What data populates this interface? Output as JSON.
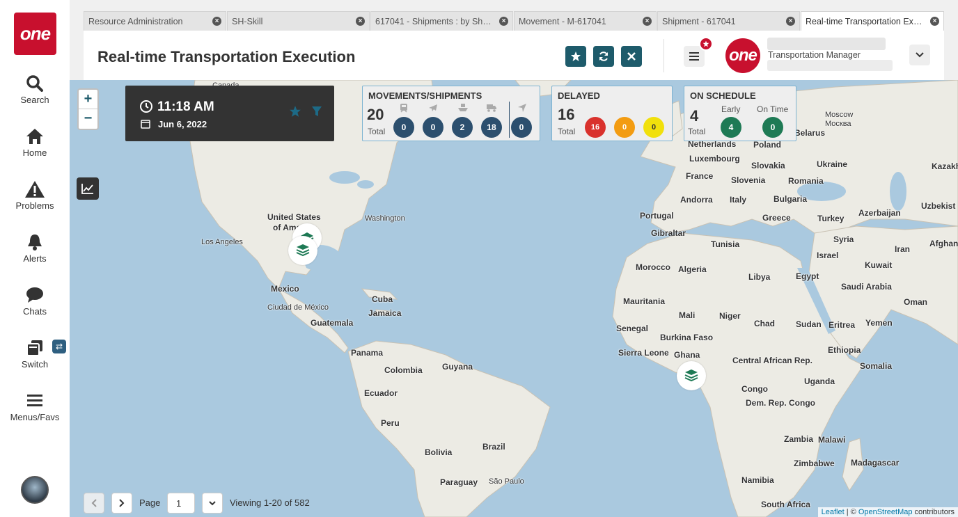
{
  "nav": {
    "logo": "one",
    "items": [
      {
        "label": "Search",
        "icon": "search-icon"
      },
      {
        "label": "Home",
        "icon": "home-icon"
      },
      {
        "label": "Problems",
        "icon": "warning-icon"
      },
      {
        "label": "Alerts",
        "icon": "bell-icon"
      },
      {
        "label": "Chats",
        "icon": "chat-icon"
      },
      {
        "label": "Switch",
        "icon": "switch-icon"
      },
      {
        "label": "Menus/Favs",
        "icon": "menu-icon"
      }
    ]
  },
  "tabs": [
    {
      "label": "Resource Administration"
    },
    {
      "label": "SH-Skill"
    },
    {
      "label": "617041 - Shipments : by Ship..."
    },
    {
      "label": "Movement - M-617041"
    },
    {
      "label": "Shipment - 617041"
    },
    {
      "label": "Real-time Transportation Exe..."
    }
  ],
  "header": {
    "title": "Real-time Transportation Execution",
    "user_logo": "one",
    "user_role": "Transportation Manager"
  },
  "clock": {
    "time": "11:18 AM",
    "date": "Jun 6, 2022"
  },
  "movements": {
    "title": "MOVEMENTS/SHIPMENTS",
    "total": "20",
    "total_label": "Total",
    "counts": [
      "0",
      "0",
      "2",
      "18",
      "0"
    ]
  },
  "delayed": {
    "title": "DELAYED",
    "total": "16",
    "total_label": "Total",
    "counts": [
      "16",
      "0",
      "0"
    ]
  },
  "on_schedule": {
    "title": "ON SCHEDULE",
    "total": "4",
    "total_label": "Total",
    "early_label": "Early",
    "ontime_label": "On Time",
    "early": "4",
    "ontime": "0"
  },
  "map_labels": [
    "Canada",
    "United States",
    "of America",
    "Los Angeles",
    "Washington",
    "Mexico",
    "Ciudad de México",
    "Cuba",
    "Jamaica",
    "Guatemala",
    "Panama",
    "Colombia",
    "Guyana",
    "Ecuador",
    "Peru",
    "Bolivia",
    "Brazil",
    "Paraguay",
    "São Paulo",
    "Netherlands",
    "Luxembourg",
    "France",
    "Andorra",
    "Portugal",
    "Gibraltar",
    "Italy",
    "Slovakia",
    "Slovenia",
    "Ukraine",
    "Romania",
    "Bulgaria",
    "Greece",
    "Turkey",
    "Poland",
    "Belarus",
    "Moscow",
    "Москва",
    "Kazakh",
    "Uzbekist",
    "Azerbaijan",
    "Syria",
    "Iran",
    "Afghani",
    "Israel",
    "Kuwait",
    "Tunisia",
    "Morocco",
    "Algeria",
    "Libya",
    "Egypt",
    "Saudi Arabia",
    "Oman",
    "Mauritania",
    "Mali",
    "Niger",
    "Chad",
    "Sudan",
    "Eritrea",
    "Yemen",
    "Senegal",
    "Burkina Faso",
    "Ethiopia",
    "Sierra Leone",
    "Ghana",
    "Central African Rep.",
    "Somalia",
    "Uganda",
    "Congo",
    "Dem. Rep. Congo",
    "Zambia",
    "Malawi",
    "Zimbabwe",
    "Madagascar",
    "Namibia",
    "South Africa"
  ],
  "pager": {
    "page_label": "Page",
    "page": "1",
    "viewing": "Viewing 1-20 of 582"
  },
  "attribution": {
    "leaflet": "Leaflet",
    "sep": " | © ",
    "osm": "OpenStreetMap",
    "suffix": " contributors"
  }
}
